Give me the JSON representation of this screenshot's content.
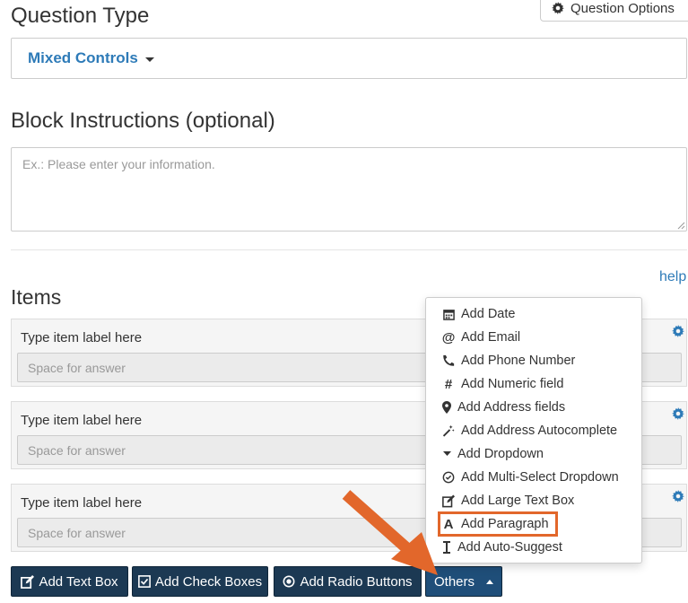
{
  "header": {
    "question_type_title": "Question Type",
    "question_options_label": "Question Options"
  },
  "question_type_select": {
    "value": "Mixed Controls"
  },
  "block_instructions": {
    "title": "Block Instructions (optional)",
    "placeholder": "Ex.: Please enter your information."
  },
  "help_link": "help",
  "items_section": {
    "title": "Items",
    "items": [
      {
        "label": "Type item label here",
        "answer_placeholder": "Space for answer"
      },
      {
        "label": "Type item label here",
        "answer_placeholder": "Space for answer"
      },
      {
        "label": "Type item label here",
        "answer_placeholder": "Space for answer"
      }
    ]
  },
  "toolbar": {
    "add_text_box": "Add Text Box",
    "add_check_boxes": "Add Check Boxes",
    "add_radio_buttons": "Add Radio Buttons",
    "others": "Others"
  },
  "others_menu": {
    "items": [
      {
        "label": "Add Date",
        "icon": "calendar-icon"
      },
      {
        "label": "Add Email",
        "icon": "at-icon"
      },
      {
        "label": "Add Phone Number",
        "icon": "phone-icon"
      },
      {
        "label": "Add Numeric field",
        "icon": "hash-icon"
      },
      {
        "label": "Add Address fields",
        "icon": "map-marker-icon"
      },
      {
        "label": "Add Address Autocomplete",
        "icon": "magic-wand-icon"
      },
      {
        "label": "Add Dropdown",
        "icon": "caret-down-icon"
      },
      {
        "label": "Add Multi-Select Dropdown",
        "icon": "check-circle-icon"
      },
      {
        "label": "Add Large Text Box",
        "icon": "edit-icon"
      },
      {
        "label": "Add Paragraph",
        "icon": "font-icon"
      },
      {
        "label": "Add Auto-Suggest",
        "icon": "text-cursor-icon"
      }
    ],
    "highlighted_item": "Add Paragraph"
  },
  "colors": {
    "link_blue": "#2e7bb8",
    "dark_button": "#1c3953",
    "others_button": "#1f4e79",
    "highlight_orange": "#e2672b"
  }
}
